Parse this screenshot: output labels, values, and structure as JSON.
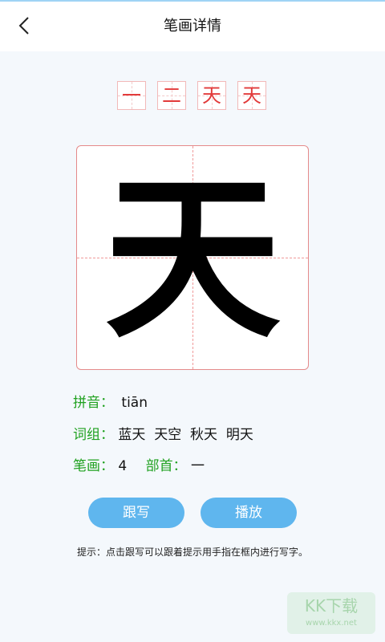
{
  "header": {
    "title": "笔画详情"
  },
  "strokes": [
    "一",
    "二",
    "天",
    "天"
  ],
  "character": "天",
  "details": {
    "pinyin_label": "拼音：",
    "pinyin": "tiān",
    "words_label": "词组：",
    "words": "蓝天  天空  秋天  明天",
    "strokes_label": "笔画：",
    "stroke_count": "4",
    "radical_label": "部首：",
    "radical": "一"
  },
  "buttons": {
    "trace": "跟写",
    "play": "播放"
  },
  "tip": "提示：点击跟写可以跟着提示用手指在框内进行写字。",
  "watermark": {
    "text": "KK下载",
    "url": "www.kkx.net"
  }
}
